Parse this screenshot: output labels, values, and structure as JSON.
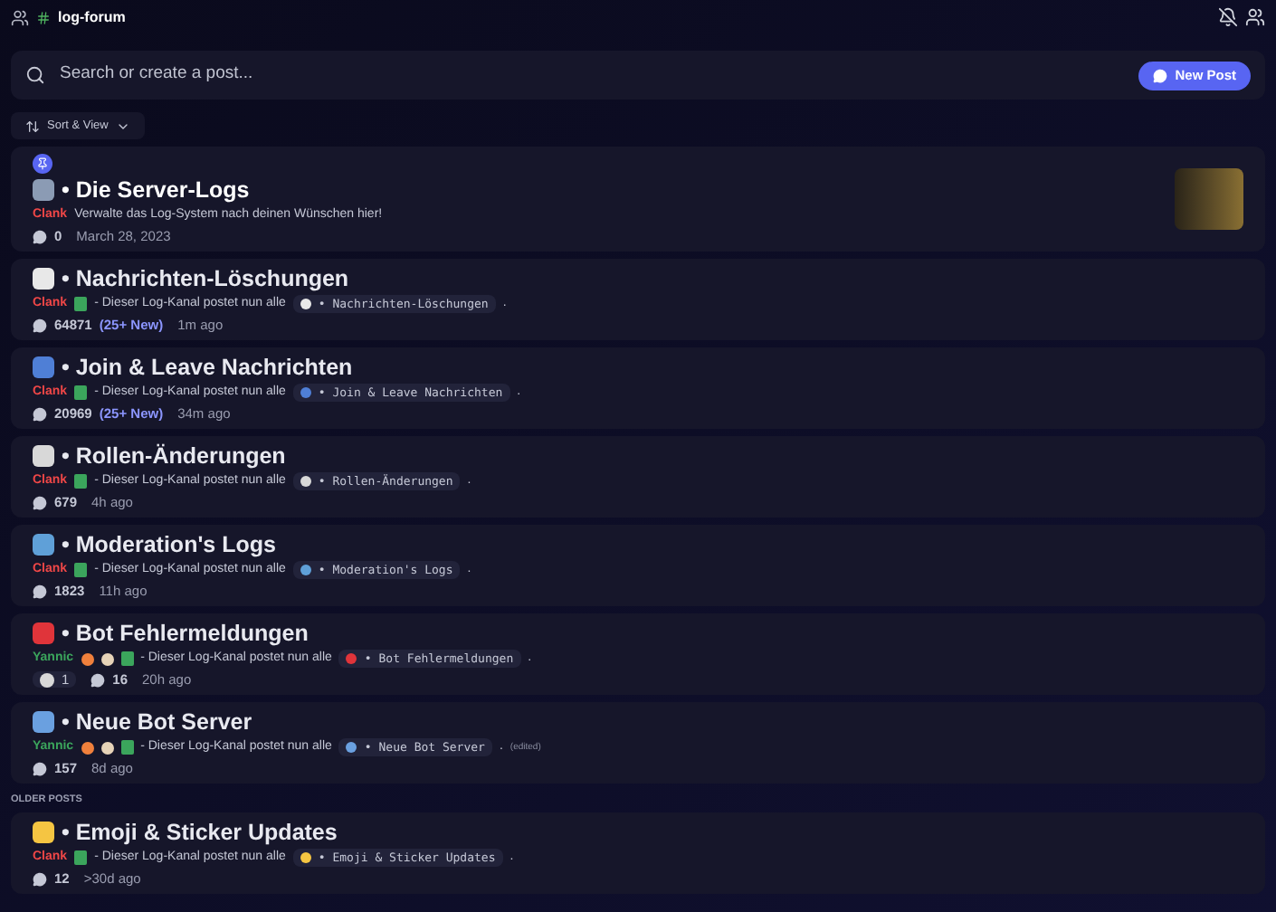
{
  "header": {
    "channel": "log-forum"
  },
  "search": {
    "placeholder": "Search or create a post...",
    "button": "New Post"
  },
  "sort": {
    "label": "Sort & View"
  },
  "posts": [
    {
      "pinned": true,
      "title": "• Die Server-Logs",
      "author": {
        "name": "Clank",
        "color": "#f04747",
        "kind": "plain"
      },
      "message": "Verwalte das Log-System nach deinen Wünschen hier!",
      "count": "0",
      "time": "March 28, 2023",
      "thumbnail": true
    },
    {
      "pinned": false,
      "title": "• Nachrichten-Löschungen",
      "author": {
        "name": "Clank",
        "color": "#f04747",
        "kind": "plain"
      },
      "message": "- Dieser Log-Kanal postet nun alle",
      "code": "• Nachrichten-Löschungen",
      "after": ".",
      "count": "64871",
      "new": "(25+ New)",
      "time": "1m ago"
    },
    {
      "pinned": false,
      "title": "• Join & Leave Nachrichten",
      "author": {
        "name": "Clank",
        "color": "#f04747",
        "kind": "plain"
      },
      "message": "- Dieser Log-Kanal postet nun alle",
      "code": "• Join & Leave Nachrichten",
      "after": ".",
      "count": "20969",
      "new": "(25+ New)",
      "time": "34m ago"
    },
    {
      "pinned": false,
      "title": "• Rollen-Änderungen",
      "author": {
        "name": "Clank",
        "color": "#f04747",
        "kind": "plain"
      },
      "message": "- Dieser Log-Kanal postet nun alle",
      "code": "• Rollen-Änderungen",
      "after": ".",
      "count": "679",
      "time": "4h ago"
    },
    {
      "pinned": false,
      "title": "• Moderation's Logs",
      "author": {
        "name": "Clank",
        "color": "#f04747",
        "kind": "plain"
      },
      "message": "- Dieser Log-Kanal postet nun alle",
      "code": "• Moderation's Logs",
      "after": ".",
      "count": "1823",
      "time": "11h ago"
    },
    {
      "pinned": false,
      "title": "• Bot Fehlermeldungen",
      "author": {
        "name": "Yannic",
        "color": "#3ba55c",
        "kind": "badged"
      },
      "message": "- Dieser Log-Kanal postet nun alle",
      "code": "• Bot Fehlermeldungen",
      "after": ".",
      "reaction": "1",
      "count": "16",
      "time": "20h ago"
    },
    {
      "pinned": false,
      "title": "• Neue Bot Server",
      "author": {
        "name": "Yannic",
        "color": "#3ba55c",
        "kind": "badged"
      },
      "message": "- Dieser Log-Kanal postet nun alle",
      "code": "• Neue Bot Server",
      "after": ".",
      "edited": "(edited)",
      "count": "157",
      "time": "8d ago"
    }
  ],
  "older_label": "OLDER POSTS",
  "older_posts": [
    {
      "pinned": false,
      "title": "• Emoji & Sticker Updates",
      "author": {
        "name": "Clank",
        "color": "#f04747",
        "kind": "plain"
      },
      "message": "- Dieser Log-Kanal postet nun alle",
      "code": "• Emoji & Sticker Updates",
      "after": ".",
      "count": "12",
      "time": ">30d ago"
    }
  ]
}
